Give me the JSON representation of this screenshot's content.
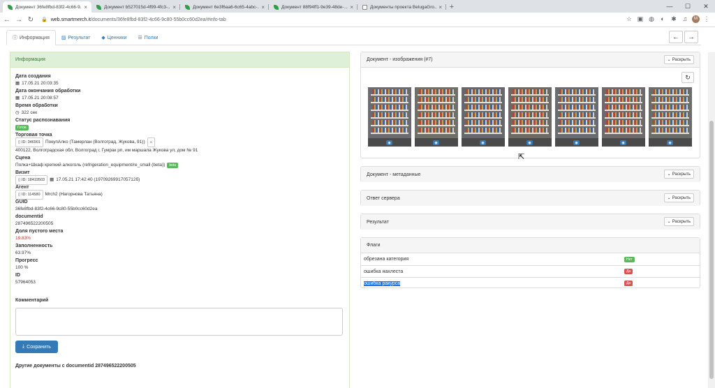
{
  "browser": {
    "tabs": [
      {
        "title": "Документ 36fe8fbd-83f2-4c66-9...",
        "active": true,
        "fav": "leaf"
      },
      {
        "title": "Документ b527015d-4f99-4fc3-...",
        "active": false,
        "fav": "leaf"
      },
      {
        "title": "Документ 6e3f6aa6-6c65-4abc-...",
        "active": false,
        "fav": "leaf"
      },
      {
        "title": "Документ 88f94ff1-9e39-48de-...",
        "active": false,
        "fav": "leaf"
      },
      {
        "title": "Документы проекта BelugaGro...",
        "active": false,
        "fav": "blank"
      }
    ],
    "url_host": "web.smartmerch.it",
    "url_path": "/documents/36fe8fbd-83f2-4c66-9c80-55b0cc60d2ea/#info-tab"
  },
  "app_tabs": [
    {
      "label": "Информация",
      "icon": "info-icon",
      "active": true
    },
    {
      "label": "Результат",
      "icon": "image-icon",
      "active": false
    },
    {
      "label": "Ценники",
      "icon": "tag-icon",
      "active": false
    },
    {
      "label": "Полки",
      "icon": "list-icon",
      "active": false
    }
  ],
  "info": {
    "header": "Информация",
    "created_label": "Дата создания",
    "created_value": "17.05.21 20:03:35",
    "processed_label": "Дата окончания обработки",
    "processed_value": "17.05.21 20:08:57",
    "duration_label": "Время обработки",
    "duration_value": "322 сек",
    "status_label": "Статус распознавания",
    "status_badge": "Готов",
    "store_label": "Торговая точка",
    "store_id": "ID: 346901",
    "store_name": "ПокупАлко (Тамерлан (Волгоград, Жукова, 91))",
    "store_address": "400122, Волгоградская обл, Волгоград г, Гумрак рп, им маршала Жукова ул, дом № 91",
    "scene_label": "Сцена",
    "scene_value": "Полка+Шкаф крепкий алкоголь (refrigeration_equipment/re_small (beta))",
    "scene_badge": "beta",
    "visit_label": "Визит",
    "visit_id": "ID: 18419503",
    "visit_value": "17.05.21 17:42:40 (1970926991705712б)",
    "agent_label": "Агент",
    "agent_id": "ID: 114580",
    "agent_value": "Mrch2 (Нагорнова Татьяна)",
    "guid_label": "GUID",
    "guid_value": "36fe8fbd-83f2-4c66-9c80-55b0cc60d2ea",
    "docid_label": "documentid",
    "docid_value": "287496522200505",
    "empty_label": "Доля пустого места",
    "empty_value": "19.83%",
    "fill_label": "Заполненность",
    "fill_value": "63.97%",
    "progress_label": "Прогресс",
    "progress_value": "100 %",
    "id_label": "ID",
    "id_value": "57964053",
    "comment_label": "Комментарий",
    "save_label": "Сохранить",
    "other_docs": "Другие документы с documentid 287496522200505"
  },
  "right": {
    "images_title": "Документ - изображения (#7)",
    "expand_label": "Раскрыть",
    "image_count": 7,
    "meta_title": "Документ - метаданные",
    "server_title": "Ответ сервера",
    "result_title": "Результат",
    "flags_title": "Флаги",
    "flags": [
      {
        "name": "обрезана категория",
        "value": "Нет",
        "color": "#5cb85c",
        "selected": false
      },
      {
        "name": "ошибка нахлеста",
        "value": "Да",
        "color": "#d9534f",
        "selected": false
      },
      {
        "name": "ошибка ракурса",
        "value": "Да",
        "color": "#d9534f",
        "selected": true
      }
    ]
  }
}
